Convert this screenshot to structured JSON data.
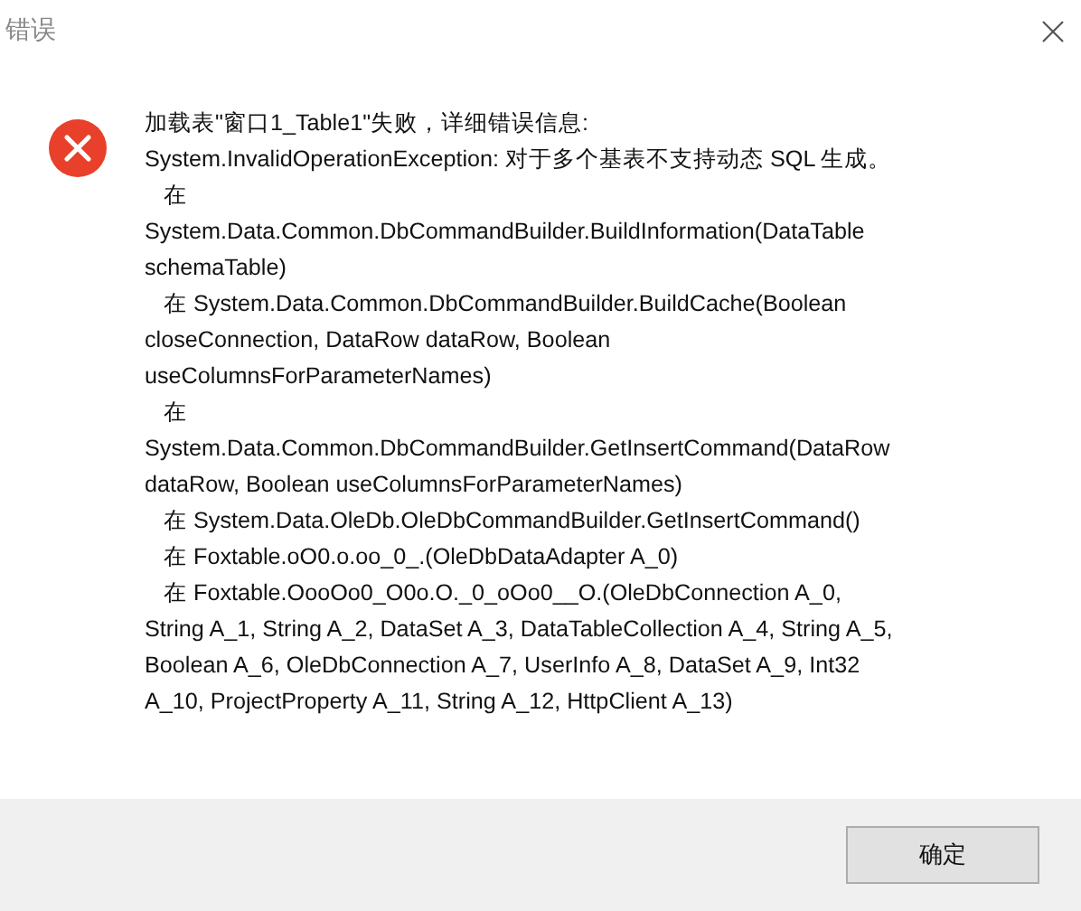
{
  "window": {
    "title": "错误"
  },
  "message_lines": [
    "加载表\"窗口1_Table1\"失败，详细错误信息:",
    "System.InvalidOperationException: 对于多个基表不支持动态 SQL 生成。",
    "   在",
    "System.Data.Common.DbCommandBuilder.BuildInformation(DataTable",
    "schemaTable)",
    "   在 System.Data.Common.DbCommandBuilder.BuildCache(Boolean",
    "closeConnection, DataRow dataRow, Boolean",
    "useColumnsForParameterNames)",
    "   在",
    "System.Data.Common.DbCommandBuilder.GetInsertCommand(DataRow",
    "dataRow, Boolean useColumnsForParameterNames)",
    "   在 System.Data.OleDb.OleDbCommandBuilder.GetInsertCommand()",
    "   在 Foxtable.oO0.o.oo_0_.(OleDbDataAdapter A_0)",
    "   在 Foxtable.OooOo0_O0o.O._0_oOo0__O.(OleDbConnection A_0,",
    "String A_1, String A_2, DataSet A_3, DataTableCollection A_4, String A_5,",
    "Boolean A_6, OleDbConnection A_7, UserInfo A_8, DataSet A_9, Int32",
    "A_10, ProjectProperty A_11, String A_12, HttpClient A_13)"
  ],
  "buttons": [
    "确定"
  ]
}
